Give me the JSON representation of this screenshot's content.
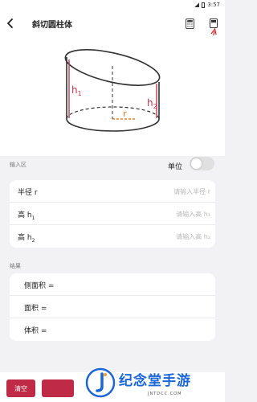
{
  "status_bar": {
    "time": "3:57"
  },
  "header": {
    "title": "斜切圆柱体",
    "back_icon": "back-arrow-icon",
    "calculator_icon": "calculator-icon",
    "save_icon": "save-icon"
  },
  "figure": {
    "h1_label": "h1",
    "h1_base": "h",
    "h1_sub": "1",
    "h2_base": "h",
    "h2_sub": "2",
    "r_label": "r",
    "colors": {
      "height_lines": "#c0394b",
      "radius_line": "#f07a2a",
      "outline": "#333333"
    }
  },
  "inputs_section": {
    "label": "输入区",
    "unit_label": "单位",
    "unit_toggle_on": false,
    "rows": [
      {
        "label_base": "半径",
        "label_var": "r",
        "label_sub": "",
        "placeholder": "请输入半径 r"
      },
      {
        "label_base": "高",
        "label_var": "h",
        "label_sub": "1",
        "placeholder": "请输入高 h₁"
      },
      {
        "label_base": "高",
        "label_var": "h",
        "label_sub": "2",
        "placeholder": "请输入高 h₂"
      }
    ]
  },
  "results_section": {
    "label": "结果",
    "rows": [
      {
        "label": "侧面积 =",
        "value": ""
      },
      {
        "label": "面积 =",
        "value": ""
      },
      {
        "label": "体积 =",
        "value": ""
      }
    ]
  },
  "bottom_bar": {
    "clear_label": "清空",
    "accent": "#bf2a46"
  },
  "watermark": {
    "brand": "纪念堂手游",
    "sub": "JNTDCC.COM"
  }
}
